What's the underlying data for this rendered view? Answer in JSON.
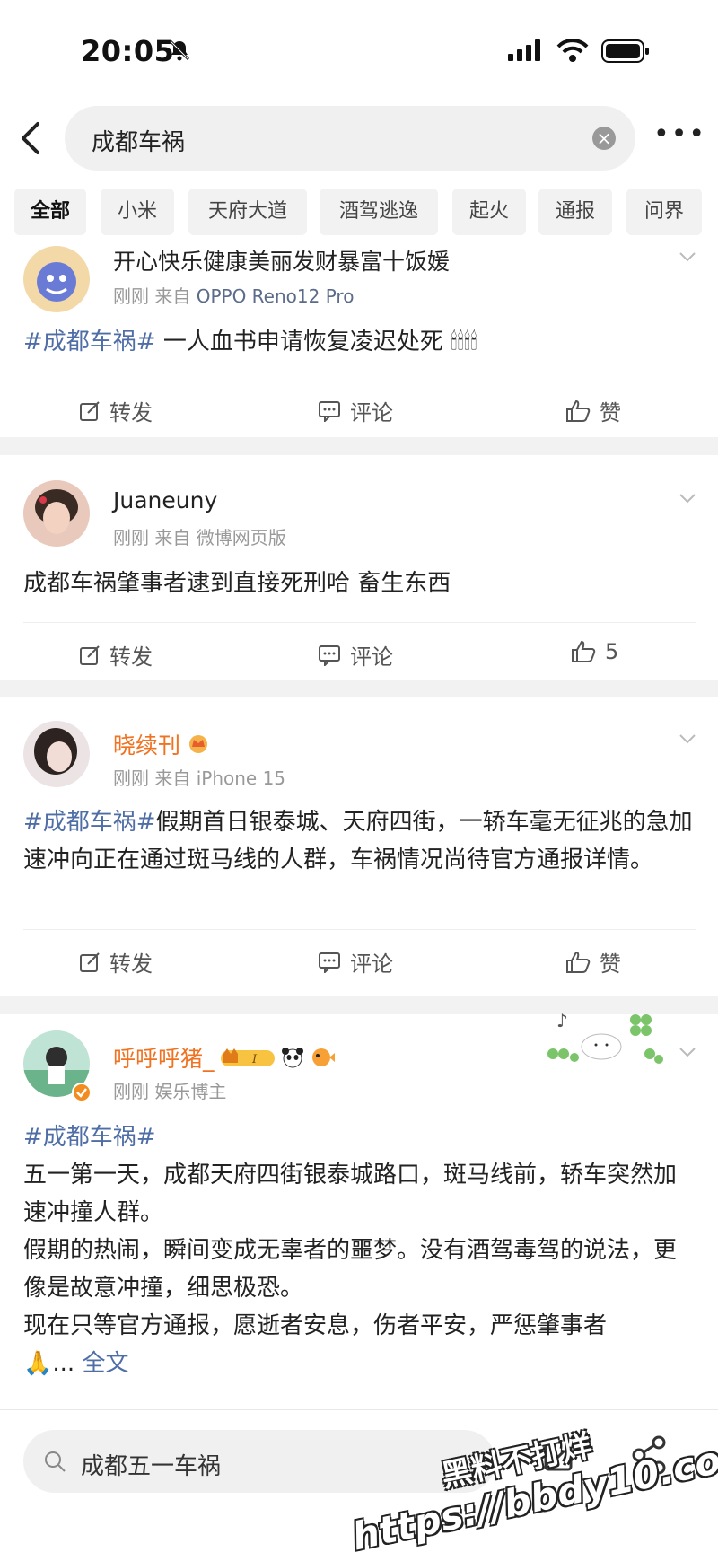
{
  "status": {
    "time": "20:05"
  },
  "search": {
    "query": "成都车祸"
  },
  "tabs": [
    "全部",
    "小米",
    "天府大道",
    "酒驾逃逸",
    "起火",
    "通报",
    "问界"
  ],
  "posts": [
    {
      "username": "开心快乐健康美丽发财暴富十饭媛",
      "time": "刚刚",
      "source_prefix": "来自",
      "source": "OPPO Reno12 Pro",
      "tag": "#成都车祸#",
      "text": " 一人血书申请恢复凌迟处死",
      "emoji": "🕯🕯🕯🕯",
      "repost": "转发",
      "comment": "评论",
      "like": "赞"
    },
    {
      "username": "Juaneuny",
      "time": "刚刚",
      "source_prefix": "来自",
      "source": "微博网页版",
      "text": "成都车祸肇事者逮到直接死刑哈 畜生东西",
      "repost": "转发",
      "comment": "评论",
      "like": "5"
    },
    {
      "username": "晓续刊",
      "time": "刚刚",
      "source_prefix": "来自",
      "source": "iPhone 15",
      "tag": "#成都车祸#",
      "text": "假期首日银泰城、天府四街，一轿车毫无征兆的急加速冲向正在通过斑马线的人群，车祸情况尚待官方通报详情。",
      "repost": "转发",
      "comment": "评论",
      "like": "赞"
    },
    {
      "username": "呼呼呼猪_",
      "time": "刚刚",
      "role": "娱乐博主",
      "tag": "#成都车祸#",
      "lines": [
        "五一第一天，成都天府四街银泰城路口，斑马线前，轿车突然加速冲撞人群。",
        "假期的热闹，瞬间变成无辜者的噩梦。没有酒驾毒驾的说法，更像是故意冲撞，细思极恐。",
        "现在只等官方通报，愿逝者安息，伤者平安，严惩肇事者"
      ],
      "ellipsis": "🙏...",
      "full_text": "全文"
    }
  ],
  "bottom": {
    "search": "成都五一车祸"
  },
  "watermark": {
    "line1": "黑料不打烊",
    "line2": "https://bbdy10.com"
  },
  "colors": {
    "link": "#4f6ea6",
    "vip_name": "#f07322"
  }
}
